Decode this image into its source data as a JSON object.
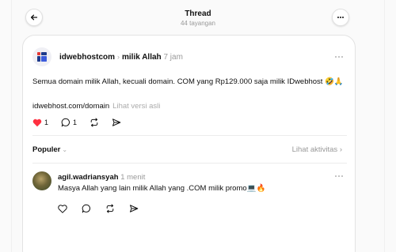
{
  "header": {
    "title": "Thread",
    "views": "44 tayangan"
  },
  "post": {
    "username": "idwebhostcom",
    "separator": "›",
    "topic": "milik Allah",
    "time": "7 jam",
    "text": "Semua domain milik Allah, kecuali domain. COM yang Rp129.000 saja milik IDwebhost 🤣🙏",
    "link": "idwebhost.com/domain",
    "link_note": "Lihat versi asli",
    "likes": "1",
    "replies": "1",
    "liked_color": "#ff3040"
  },
  "sort": {
    "label": "Populer",
    "chevron": "⌄",
    "activity_link": "Lihat aktivitas",
    "activity_chevron": "›"
  },
  "reply": {
    "username": "agil.wadriansyah",
    "time": "1 menit",
    "text": "Masya Allah yang lain milik Allah yang .COM milik promo💻🔥"
  }
}
